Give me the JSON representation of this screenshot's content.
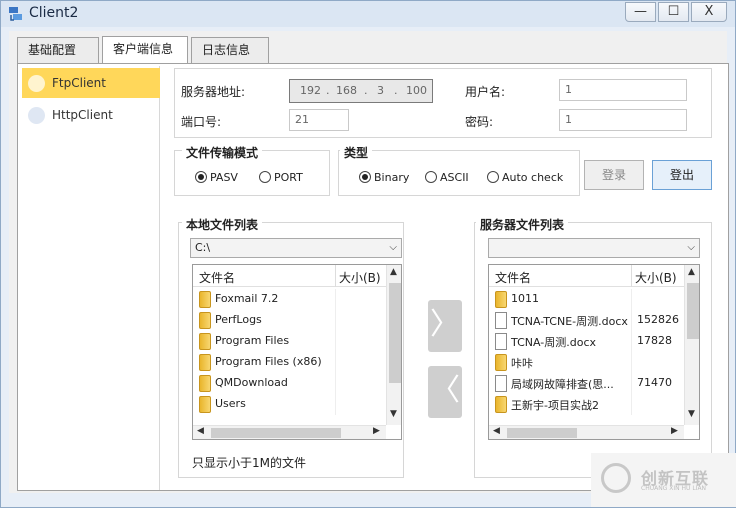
{
  "window": {
    "title": "Client2",
    "min_glyph": "—",
    "max_glyph": "☐",
    "close_glyph": "X"
  },
  "tabs": [
    {
      "label": "基础配置",
      "active": false
    },
    {
      "label": "客户端信息",
      "active": true
    },
    {
      "label": "日志信息",
      "active": false
    }
  ],
  "sidebar": {
    "items": [
      {
        "label": "FtpClient",
        "selected": true
      },
      {
        "label": "HttpClient",
        "selected": false
      }
    ]
  },
  "connection": {
    "server_label": "服务器地址:",
    "ip": [
      "192",
      "168",
      "3",
      "100"
    ],
    "username_label": "用户名:",
    "username_value": "1",
    "port_label": "端口号:",
    "port_value": "21",
    "password_label": "密码:",
    "password_value": "1"
  },
  "transfer_mode": {
    "title": "文件传输模式",
    "options": [
      {
        "label": "PASV",
        "checked": true
      },
      {
        "label": "PORT",
        "checked": false
      }
    ]
  },
  "type": {
    "title": "类型",
    "options": [
      {
        "label": "Binary",
        "checked": true
      },
      {
        "label": "ASCII",
        "checked": false
      },
      {
        "label": "Auto check",
        "checked": false
      }
    ]
  },
  "buttons": {
    "login": "登录",
    "logout": "登出",
    "upload_glyph": "〉",
    "download_glyph": "〈"
  },
  "local": {
    "title": "本地文件列表",
    "path": "C:\\",
    "col_name": "文件名",
    "col_size": "大小(B)",
    "rows": [
      {
        "name": "Foxmail 7.2",
        "size": "",
        "kind": "folder"
      },
      {
        "name": "PerfLogs",
        "size": "",
        "kind": "folder"
      },
      {
        "name": "Program Files",
        "size": "",
        "kind": "folder"
      },
      {
        "name": "Program Files (x86)",
        "size": "",
        "kind": "folder"
      },
      {
        "name": "QMDownload",
        "size": "",
        "kind": "folder"
      },
      {
        "name": "Users",
        "size": "",
        "kind": "folder"
      }
    ]
  },
  "remote": {
    "title": "服务器文件列表",
    "path": "",
    "col_name": "文件名",
    "col_size": "大小(B)",
    "rows": [
      {
        "name": "1011",
        "size": "",
        "kind": "folder"
      },
      {
        "name": "TCNA-TCNE-周测.docx",
        "size": "152826",
        "kind": "doc"
      },
      {
        "name": "TCNA-周测.docx",
        "size": "17828",
        "kind": "doc"
      },
      {
        "name": "咔咔",
        "size": "",
        "kind": "folder"
      },
      {
        "name": "局域网故障排查(思...",
        "size": "71470",
        "kind": "doc"
      },
      {
        "name": "王新宇-项目实战2",
        "size": "",
        "kind": "folder"
      }
    ]
  },
  "note": "只显示小于1M的文件",
  "watermark": {
    "text": "创新互联",
    "sub": "CHUANG XIN HU LIAN"
  },
  "colors": {
    "selected_item": "#ffd75a",
    "logout_border": "#6aa1d6",
    "folder": "#f0c040"
  }
}
